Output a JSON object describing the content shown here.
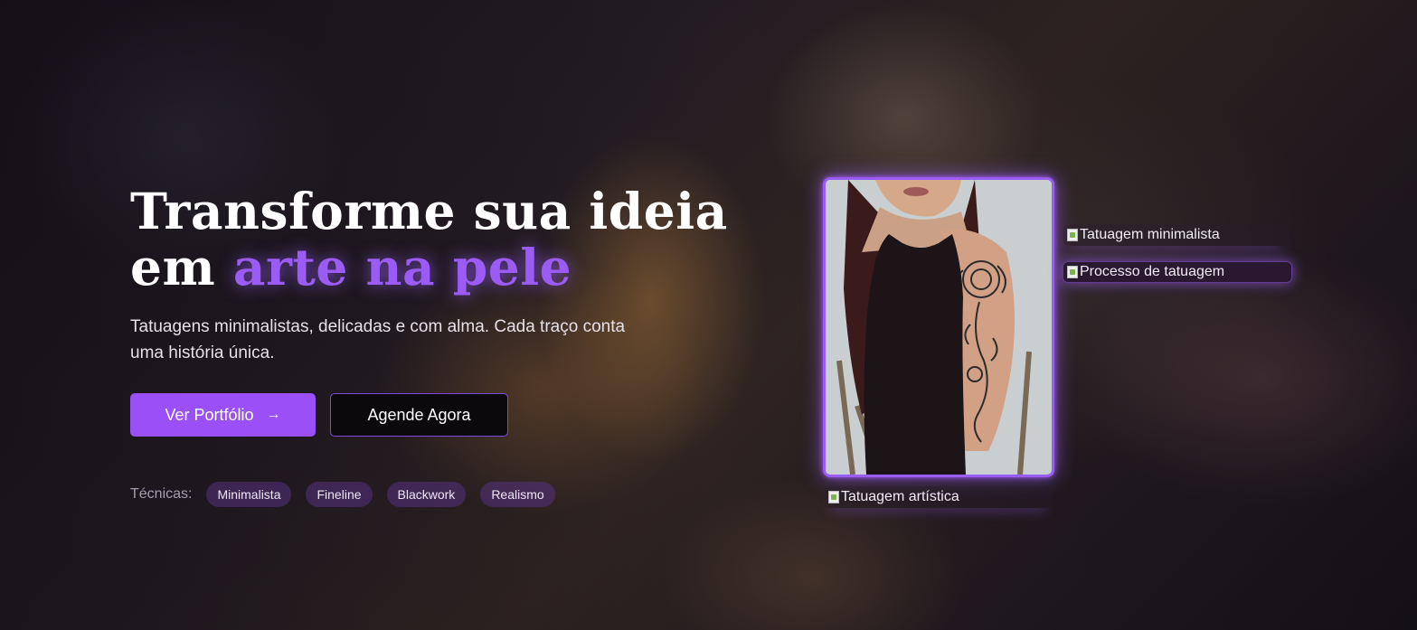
{
  "hero": {
    "title_line1": "Transforme sua ideia",
    "title_line2_prefix": "em ",
    "title_line2_accent": "arte na pele",
    "subtitle": "Tatuagens minimalistas, delicadas e com alma. Cada traço conta uma história única."
  },
  "buttons": {
    "portfolio_label": "Ver Portfólio",
    "portfolio_icon": "arrow-right-icon",
    "schedule_label": "Agende Agora"
  },
  "techniques": {
    "label": "Técnicas:",
    "tags": [
      "Minimalista",
      "Fineline",
      "Blackwork",
      "Realismo"
    ]
  },
  "gallery": {
    "main_photo_name": "tattoo-arm-photo",
    "images": [
      {
        "alt": "Tatuagem minimalista"
      },
      {
        "alt": "Processo de tatuagem"
      },
      {
        "alt": "Tatuagem artística"
      }
    ]
  },
  "colors": {
    "accent": "#9b5cf6",
    "button_primary": "#9b4ff7",
    "button_secondary_bg": "#0b090c",
    "tag_bg": "#58328c"
  }
}
